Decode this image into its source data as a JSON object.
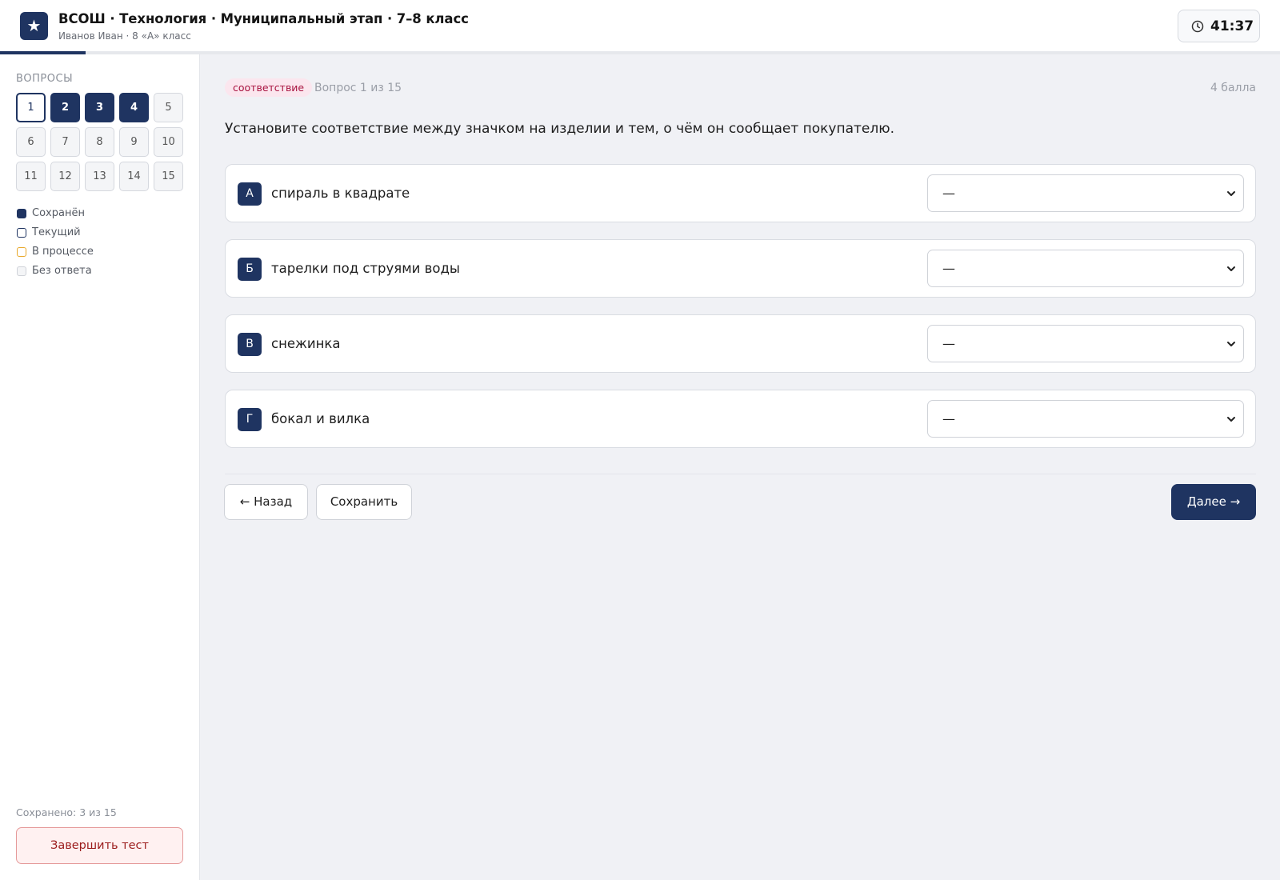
{
  "header": {
    "logo_glyph": "★",
    "title": "ВСОШ · Технология · Муниципальный этап · 7–8 класс",
    "subtitle": "Иванов Иван · 8 «А» класс",
    "timer": "41:37",
    "progress_fraction": 0.0667
  },
  "sidebar": {
    "label": "ВОПРОСЫ",
    "questions": [
      {
        "num": "1",
        "state": "current"
      },
      {
        "num": "2",
        "state": "saved"
      },
      {
        "num": "3",
        "state": "saved"
      },
      {
        "num": "4",
        "state": "saved"
      },
      {
        "num": "5",
        "state": "none"
      },
      {
        "num": "6",
        "state": "none"
      },
      {
        "num": "7",
        "state": "none"
      },
      {
        "num": "8",
        "state": "none"
      },
      {
        "num": "9",
        "state": "none"
      },
      {
        "num": "10",
        "state": "none"
      },
      {
        "num": "11",
        "state": "none"
      },
      {
        "num": "12",
        "state": "none"
      },
      {
        "num": "13",
        "state": "none"
      },
      {
        "num": "14",
        "state": "none"
      },
      {
        "num": "15",
        "state": "none"
      }
    ],
    "legend": [
      {
        "label": "Сохранён",
        "kind": "saved"
      },
      {
        "label": "Текущий",
        "kind": "current"
      },
      {
        "label": "В процессе",
        "kind": "progress"
      },
      {
        "label": "Без ответа",
        "kind": "none"
      }
    ],
    "saved_count": "Сохранено: 3 из 15",
    "finish_label": "Завершить тест"
  },
  "question": {
    "type_tag": "соответствие",
    "progress": "Вопрос 1 из 15",
    "points": "4 балла",
    "text": "Установите соответствие между значком на изделии и тем, о чём он сообщает покупателю.",
    "rows": [
      {
        "letter": "А",
        "label": "спираль в квадрате",
        "selected": "—"
      },
      {
        "letter": "Б",
        "label": "тарелки под струями воды",
        "selected": "—"
      },
      {
        "letter": "В",
        "label": "снежинка",
        "selected": "—"
      },
      {
        "letter": "Г",
        "label": "бокал и вилка",
        "selected": "—"
      }
    ]
  },
  "nav": {
    "back_label": "← Назад",
    "save_label": "Сохранить",
    "next_label": "Далее →"
  },
  "colors": {
    "accent": "#1f3461",
    "tag_bg": "#fbe6ee",
    "tag_text": "#a8123f",
    "danger": "#9b1c1c",
    "in_progress": "#e8a82a"
  }
}
